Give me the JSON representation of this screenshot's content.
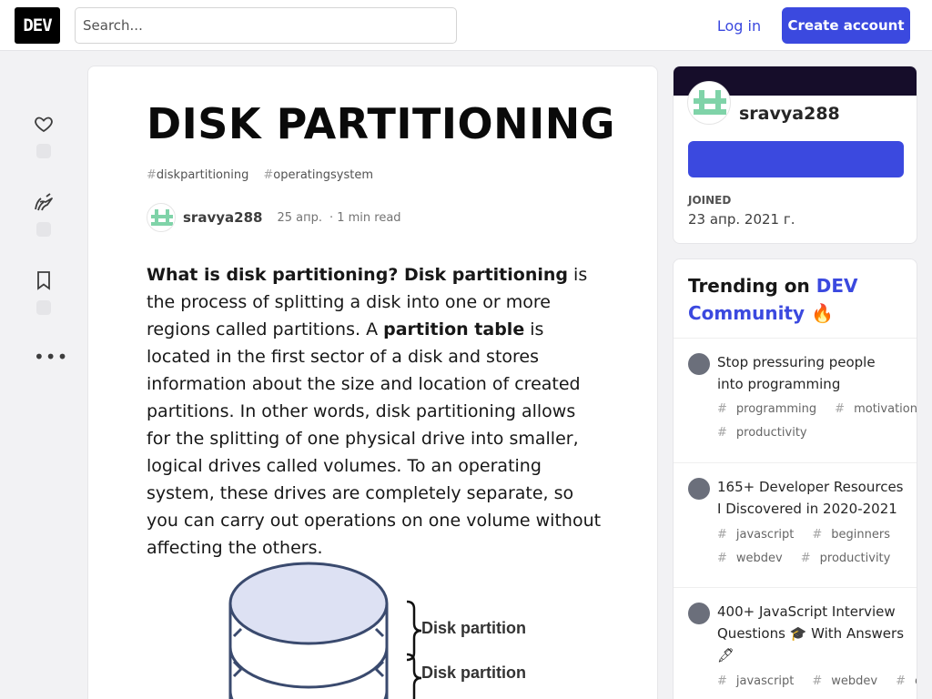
{
  "header": {
    "logo_text": "DEV",
    "search_placeholder": "Search...",
    "login_label": "Log in",
    "create_account_label": "Create account"
  },
  "article": {
    "title": "DISK PARTITIONING",
    "tags": [
      "diskpartitioning",
      "operatingsystem"
    ],
    "author_name": "sravya288",
    "date": "25 апр.",
    "read_time": "· 1 min read",
    "body": {
      "lead_bold": "What is disk partitioning? Disk partitioning",
      "text1": " is the process of splitting a disk into one or more regions called partitions. A ",
      "bold2": "partition table",
      "text2": " is located in the first sector of a disk and stores information about the size and location of created partitions. In other words, disk partitioning allows for the splitting of one physical drive into smaller, logical drives called volumes. To an operating system, these drives are completely separate, so you can carry out operations on one volume without affecting the others."
    },
    "figure_labels": [
      "Disk partition",
      "Disk partition"
    ]
  },
  "sidebar_profile": {
    "name": "sravya288",
    "joined_label": "JOINED",
    "joined_value": "23 апр. 2021 г."
  },
  "trending": {
    "heading_prefix": "Trending on ",
    "heading_brand": "DEV Community",
    "heading_emoji": "🔥",
    "items": [
      {
        "title": "Stop pressuring people into programming",
        "tags": [
          "programming",
          "motivation",
          "productivity"
        ]
      },
      {
        "title": "165+ Developer Resources I Discovered in 2020-2021",
        "tags": [
          "javascript",
          "beginners",
          "webdev",
          "productivity"
        ]
      },
      {
        "title": "400+ JavaScript Interview Questions 🎓 With Answers 🖋",
        "tags": [
          "javascript",
          "webdev",
          "career"
        ]
      }
    ]
  },
  "colors": {
    "brand": "#3b49df",
    "profile_band": "#160d2a",
    "avatar_green": "#7fd3a8"
  }
}
